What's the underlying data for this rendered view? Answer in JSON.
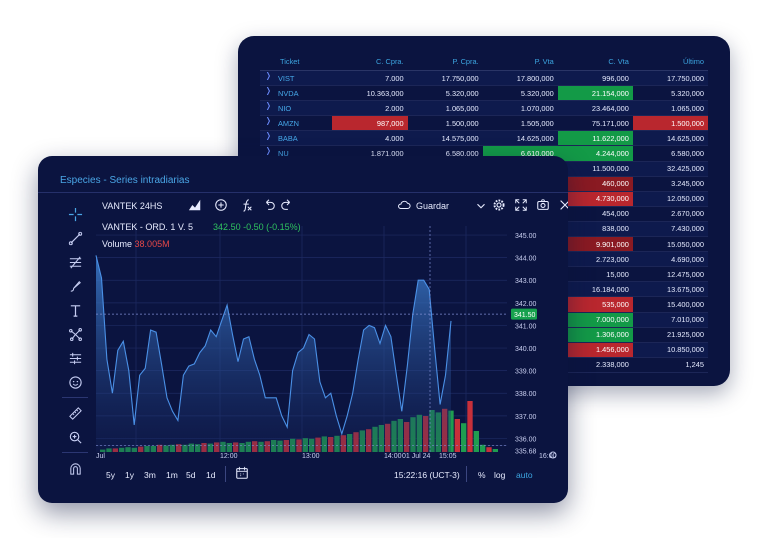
{
  "quotes": {
    "headers": [
      "Ticket",
      "C. Cpra.",
      "P. Cpra.",
      "P. Vta",
      "C. Vta",
      "Último"
    ],
    "rows": [
      {
        "ticket": "VIST",
        "c_cpra": "7.000",
        "p_cpra": "17.750,000",
        "p_vta": "17.800,000",
        "c_vta": "996,000",
        "ultimo": "17.750,000",
        "hl": {}
      },
      {
        "ticket": "NVDA",
        "c_cpra": "10.363,000",
        "p_cpra": "5.320,000",
        "p_vta": "5.320,000",
        "c_vta": "21.154,000",
        "ultimo": "5.320,000",
        "hl": {
          "c_vta": "g"
        }
      },
      {
        "ticket": "NIO",
        "c_cpra": "2.000",
        "p_cpra": "1.065,000",
        "p_vta": "1.070,000",
        "c_vta": "23.464,000",
        "ultimo": "1.065,000",
        "hl": {}
      },
      {
        "ticket": "AMZN",
        "c_cpra": "987,000",
        "p_cpra": "1.500,000",
        "p_vta": "1.505,000",
        "c_vta": "75.171,000",
        "ultimo": "1.500,000",
        "hl": {
          "c_cpra": "r",
          "ultimo": "r"
        }
      },
      {
        "ticket": "BABA",
        "c_cpra": "4.000",
        "p_cpra": "14.575,000",
        "p_vta": "14.625,000",
        "c_vta": "11.622,000",
        "ultimo": "14.625,000",
        "hl": {
          "c_vta": "g"
        }
      },
      {
        "ticket": "NU",
        "c_cpra": "1.871,000",
        "p_cpra": "6.580,000",
        "p_vta": "6.610,000",
        "c_vta": "4.244,000",
        "ultimo": "6.580,000",
        "hl": {
          "p_vta": "g",
          "c_vta": "g"
        }
      },
      {
        "ticket": "",
        "c_cpra": "",
        "p_cpra": "",
        "p_vta": "",
        "c_vta": "11.500,000",
        "ultimo": "32.425,000",
        "hl": {}
      },
      {
        "ticket": "",
        "c_cpra": "",
        "p_cpra": "",
        "p_vta": "",
        "c_vta": "460,000",
        "ultimo": "3.245,000",
        "hl": {
          "c_vta": "d"
        }
      },
      {
        "ticket": "",
        "c_cpra": "",
        "p_cpra": "",
        "p_vta": "",
        "c_vta": "4.730,000",
        "ultimo": "12.050,000",
        "hl": {
          "c_vta": "r"
        }
      },
      {
        "ticket": "",
        "c_cpra": "",
        "p_cpra": "",
        "p_vta": "",
        "c_vta": "454,000",
        "ultimo": "2.670,000",
        "hl": {}
      },
      {
        "ticket": "",
        "c_cpra": "",
        "p_cpra": "",
        "p_vta": "",
        "c_vta": "838,000",
        "ultimo": "7.430,000",
        "hl": {}
      },
      {
        "ticket": "",
        "c_cpra": "",
        "p_cpra": "",
        "p_vta": "",
        "c_vta": "9.901,000",
        "ultimo": "15.050,000",
        "hl": {
          "c_vta": "d"
        }
      },
      {
        "ticket": "",
        "c_cpra": "",
        "p_cpra": "",
        "p_vta": "",
        "c_vta": "2.723,000",
        "ultimo": "4.690,000",
        "hl": {}
      },
      {
        "ticket": "",
        "c_cpra": "",
        "p_cpra": "",
        "p_vta": "",
        "c_vta": "15,000",
        "ultimo": "12.475,000",
        "hl": {}
      },
      {
        "ticket": "",
        "c_cpra": "",
        "p_cpra": "",
        "p_vta": "",
        "c_vta": "16.184,000",
        "ultimo": "13.675,000",
        "hl": {}
      },
      {
        "ticket": "",
        "c_cpra": "",
        "p_cpra": "",
        "p_vta": "",
        "c_vta": "535,000",
        "ultimo": "15.400,000",
        "hl": {
          "c_vta": "r"
        }
      },
      {
        "ticket": "",
        "c_cpra": "",
        "p_cpra": "",
        "p_vta": "",
        "c_vta": "7.000,000",
        "ultimo": "7.010,000",
        "hl": {
          "c_vta": "g"
        }
      },
      {
        "ticket": "",
        "c_cpra": "",
        "p_cpra": "",
        "p_vta": "",
        "c_vta": "1.306,000",
        "ultimo": "21.925,000",
        "hl": {
          "c_vta": "g"
        }
      },
      {
        "ticket": "",
        "c_cpra": "",
        "p_cpra": "",
        "p_vta": "",
        "c_vta": "1.456,000",
        "ultimo": "10.850,000",
        "hl": {
          "c_vta": "r"
        }
      },
      {
        "ticket": "",
        "c_cpra": "",
        "p_cpra": "",
        "p_vta": "",
        "c_vta": "2.338,000",
        "ultimo": "1,245",
        "hl": {}
      }
    ]
  },
  "chart_panel": {
    "title": "Especies - Series intradiarias",
    "symbol": "VANTEK 24HS",
    "save_label": "Guardar",
    "legend": {
      "name": "VANTEK - ORD. 1 V. 5",
      "quote": "342.50 -0.50 (-0.15%)"
    },
    "volume": {
      "label": "Volume",
      "value": "38.005M"
    },
    "ranges": [
      "5y",
      "1y",
      "3m",
      "1m",
      "5d",
      "1d"
    ],
    "time": "15:22:16 (UCT-3)",
    "opts": {
      "pct": "%",
      "log": "log",
      "auto": "auto"
    },
    "left_tool_icons": [
      "crosshair-icon",
      "trend-line-icon",
      "fib-tool-icon",
      "brush-icon",
      "text-tool-icon",
      "pattern-icon",
      "forecast-icon",
      "emoji-icon",
      "ruler-icon",
      "zoom-in-icon",
      "magnet-icon"
    ],
    "colors": {
      "up": "#1f9d50",
      "down": "#c8303a",
      "line": "#4a90e6",
      "accent": "#3ca5e0"
    }
  },
  "chart_data": {
    "type": "area",
    "y_ticks": [
      "345.00",
      "344.00",
      "343.00",
      "342.00",
      "341.00",
      "340.00",
      "339.00",
      "338.00",
      "337.00",
      "336.00",
      "335.68"
    ],
    "y_range": [
      335.4,
      345.4
    ],
    "current_price_label": "341.50",
    "x_labels": [
      "Jul",
      "12:00",
      "13:00",
      "14:00",
      "01 Jul 24",
      "15:05",
      "16:00"
    ],
    "price_series": [
      344.1,
      343.1,
      339.5,
      338.0,
      339.9,
      340.3,
      339.0,
      336.6,
      338.8,
      339.1,
      340.8,
      340.7,
      339.3,
      337.8,
      337.2,
      336.8,
      338.8,
      339.2,
      339.3,
      339.8,
      340.1,
      340.8,
      340.5,
      341.2,
      341.9,
      340.6,
      339.4,
      340.4,
      340.5,
      339.5,
      338.8,
      337.8,
      337.8,
      337.8,
      337.0,
      336.5,
      339.0,
      339.8,
      340.0,
      340.6,
      340.4,
      338.5,
      337.8,
      338.0,
      337.0,
      336.2,
      337.0,
      338.0,
      339.5,
      340.8,
      341.0,
      340.9,
      340.2,
      341.0,
      340.5,
      338.8,
      337.2,
      339.2,
      341.5,
      343.0,
      343.0,
      342.6,
      340.0,
      337.5,
      338.8,
      341.2
    ],
    "volume_bars": [
      {
        "v": 0.04,
        "up": true
      },
      {
        "v": 0.06,
        "up": true
      },
      {
        "v": 0.06,
        "up": false
      },
      {
        "v": 0.07,
        "up": true
      },
      {
        "v": 0.08,
        "up": true
      },
      {
        "v": 0.07,
        "up": true
      },
      {
        "v": 0.09,
        "up": false
      },
      {
        "v": 0.1,
        "up": true
      },
      {
        "v": 0.1,
        "up": true
      },
      {
        "v": 0.12,
        "up": false
      },
      {
        "v": 0.11,
        "up": true
      },
      {
        "v": 0.12,
        "up": true
      },
      {
        "v": 0.13,
        "up": false
      },
      {
        "v": 0.12,
        "up": true
      },
      {
        "v": 0.14,
        "up": true
      },
      {
        "v": 0.13,
        "up": true
      },
      {
        "v": 0.15,
        "up": false
      },
      {
        "v": 0.14,
        "up": true
      },
      {
        "v": 0.16,
        "up": false
      },
      {
        "v": 0.17,
        "up": true
      },
      {
        "v": 0.15,
        "up": true
      },
      {
        "v": 0.16,
        "up": false
      },
      {
        "v": 0.15,
        "up": true
      },
      {
        "v": 0.17,
        "up": true
      },
      {
        "v": 0.18,
        "up": false
      },
      {
        "v": 0.17,
        "up": true
      },
      {
        "v": 0.18,
        "up": false
      },
      {
        "v": 0.2,
        "up": true
      },
      {
        "v": 0.19,
        "up": true
      },
      {
        "v": 0.2,
        "up": false
      },
      {
        "v": 0.22,
        "up": true
      },
      {
        "v": 0.21,
        "up": false
      },
      {
        "v": 0.23,
        "up": true
      },
      {
        "v": 0.22,
        "up": true
      },
      {
        "v": 0.24,
        "up": false
      },
      {
        "v": 0.26,
        "up": true
      },
      {
        "v": 0.25,
        "up": false
      },
      {
        "v": 0.27,
        "up": true
      },
      {
        "v": 0.28,
        "up": false
      },
      {
        "v": 0.3,
        "up": true
      },
      {
        "v": 0.33,
        "up": false
      },
      {
        "v": 0.36,
        "up": true
      },
      {
        "v": 0.38,
        "up": false
      },
      {
        "v": 0.42,
        "up": true
      },
      {
        "v": 0.45,
        "up": true
      },
      {
        "v": 0.47,
        "up": false
      },
      {
        "v": 0.52,
        "up": true
      },
      {
        "v": 0.55,
        "up": true
      },
      {
        "v": 0.5,
        "up": false
      },
      {
        "v": 0.58,
        "up": true
      },
      {
        "v": 0.62,
        "up": true
      },
      {
        "v": 0.6,
        "up": false
      },
      {
        "v": 0.7,
        "up": true
      },
      {
        "v": 0.66,
        "up": true
      },
      {
        "v": 0.72,
        "up": false
      },
      {
        "v": 0.69,
        "up": true
      },
      {
        "v": 0.55,
        "up": false
      },
      {
        "v": 0.48,
        "up": true
      },
      {
        "v": 0.85,
        "up": false
      },
      {
        "v": 0.35,
        "up": true
      },
      {
        "v": 0.12,
        "up": true
      },
      {
        "v": 0.08,
        "up": false
      },
      {
        "v": 0.05,
        "up": true
      }
    ]
  }
}
